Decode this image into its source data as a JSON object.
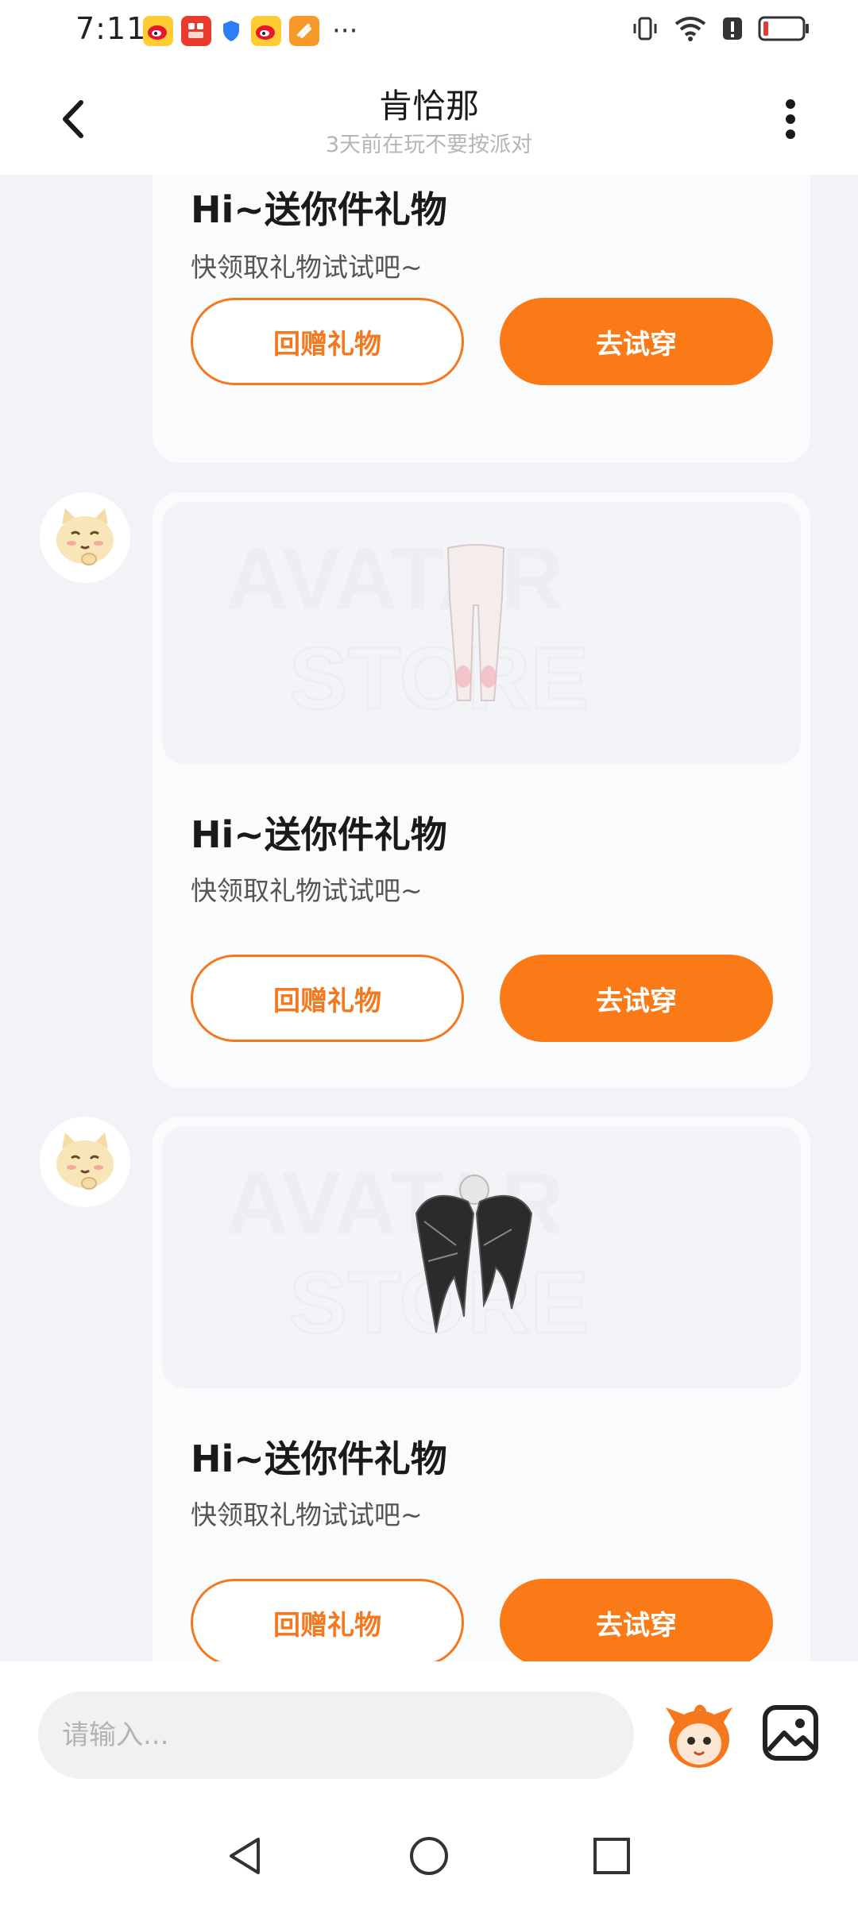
{
  "status_bar": {
    "time": "7:11",
    "more_dots": "···"
  },
  "header": {
    "title": "肯恰那",
    "subtitle": "3天前在玩不要按派对"
  },
  "messages": [
    {
      "title": "Hi~送你件礼物",
      "subtitle": "快领取礼物试试吧~",
      "return_gift_label": "回赠礼物",
      "try_on_label": "去试穿"
    },
    {
      "item": "leggings",
      "watermark": "AVATAR STORE",
      "title": "Hi~送你件礼物",
      "subtitle": "快领取礼物试试吧~",
      "return_gift_label": "回赠礼物",
      "try_on_label": "去试穿"
    },
    {
      "item": "wings",
      "watermark": "AVATAR STORE",
      "title": "Hi~送你件礼物",
      "subtitle": "快领取礼物试试吧~",
      "return_gift_label": "回赠礼物",
      "try_on_label": "去试穿"
    }
  ],
  "input": {
    "placeholder": "请输入..."
  },
  "colors": {
    "accent": "#fb7a18",
    "background": "#f2f3f6",
    "card": "#fafbfc"
  },
  "icons": [
    "back-arrow-icon",
    "more-vertical-icon",
    "mascot-icon",
    "image-icon",
    "nav-back-icon",
    "nav-home-icon",
    "nav-recent-icon"
  ]
}
